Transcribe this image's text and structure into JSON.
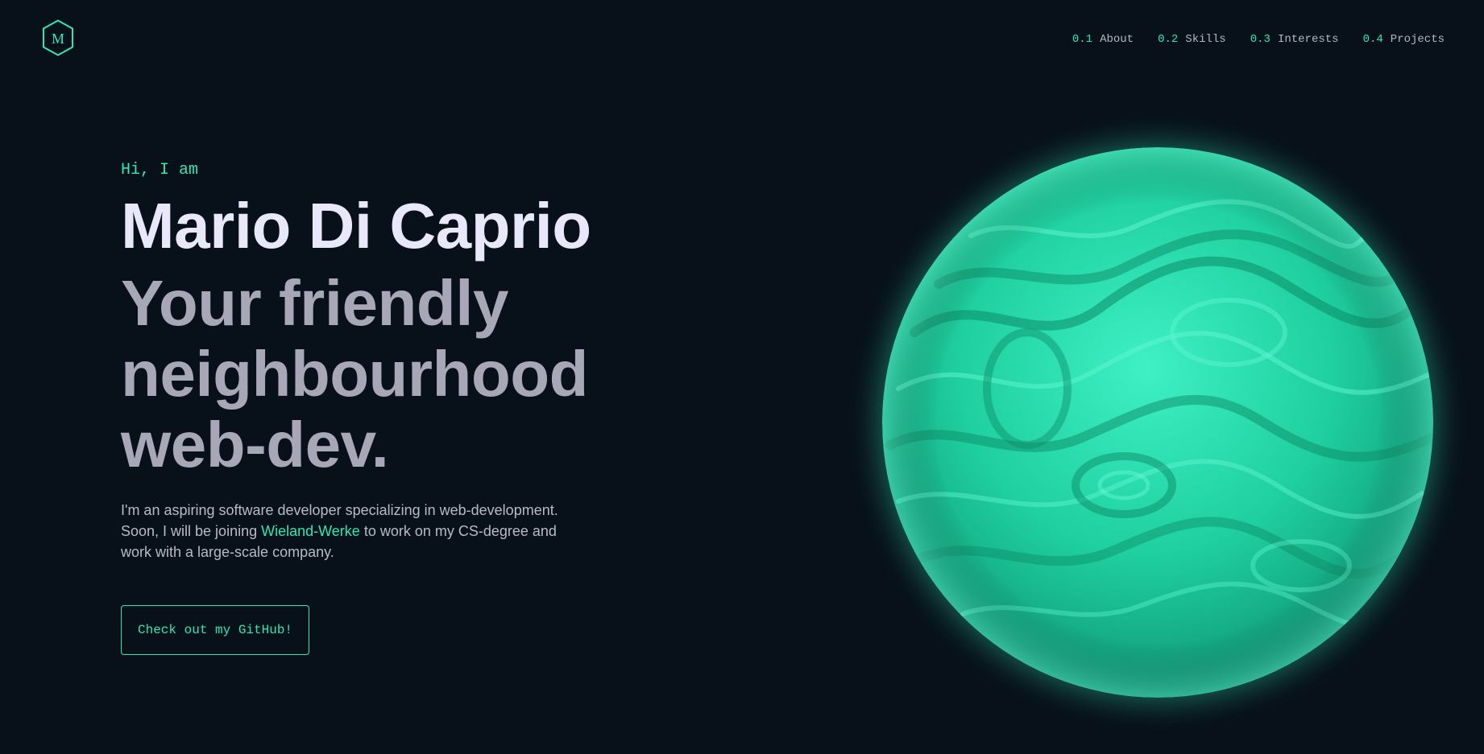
{
  "header": {
    "logo_letter": "M",
    "nav": [
      {
        "num": "0.1",
        "label": "About"
      },
      {
        "num": "0.2",
        "label": "Skills"
      },
      {
        "num": "0.3",
        "label": "Interests"
      },
      {
        "num": "0.4",
        "label": "Projects"
      }
    ]
  },
  "hero": {
    "greeting": "Hi, I am",
    "name": "Mario Di Caprio",
    "tagline_1": "Your friendly",
    "tagline_2": "neighbourhood",
    "tagline_3": "web-dev.",
    "intro_part1": "I'm an aspiring software developer specializing in web-development. Soon, I will be joining ",
    "intro_link": "Wieland-Werke",
    "intro_part2": " to work on my CS-degree and work with a large-scale company.",
    "cta_label": "Check out my GitHub!"
  },
  "colors": {
    "background": "#08111a",
    "accent": "#2ee8b4",
    "name_text": "#e8e8fa",
    "tagline_text": "#a8a7b8"
  },
  "icons": {
    "logo": "hexagon-logo-icon",
    "orb": "green-3d-sphere-image"
  }
}
